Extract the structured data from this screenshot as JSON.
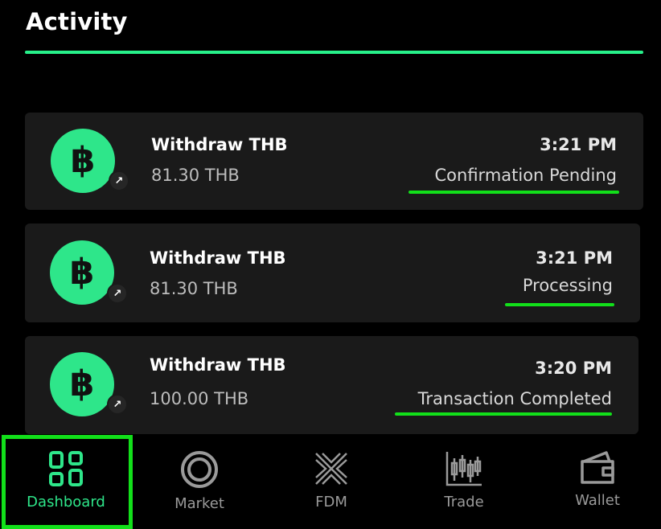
{
  "header": {
    "title": "Activity"
  },
  "activity": [
    {
      "title": "Withdraw THB",
      "amount": "81.30 THB",
      "time": "3:21 PM",
      "status": "Confirmation Pending",
      "coin_symbol": "฿",
      "badge_icon": "arrow-up-right-icon"
    },
    {
      "title": "Withdraw THB",
      "amount": "81.30 THB",
      "time": "3:21 PM",
      "status": "Processing",
      "coin_symbol": "฿",
      "badge_icon": "arrow-up-right-icon"
    },
    {
      "title": "Withdraw THB",
      "amount": "100.00 THB",
      "time": "3:20 PM",
      "status": "Transaction Completed",
      "coin_symbol": "฿",
      "badge_icon": "arrow-up-right-icon"
    }
  ],
  "nav": {
    "items": [
      {
        "label": "Dashboard",
        "icon": "dashboard-grid-icon",
        "active": true
      },
      {
        "label": "Market",
        "icon": "market-ring-icon",
        "active": false
      },
      {
        "label": "FDM",
        "icon": "fdm-x-icon",
        "active": false
      },
      {
        "label": "Trade",
        "icon": "candlestick-chart-icon",
        "active": false
      },
      {
        "label": "Wallet",
        "icon": "wallet-icon",
        "active": false
      }
    ]
  },
  "colors": {
    "accent": "#2ee68a",
    "highlight": "#12e01a",
    "background": "#000000",
    "card": "#1a1a1a"
  }
}
